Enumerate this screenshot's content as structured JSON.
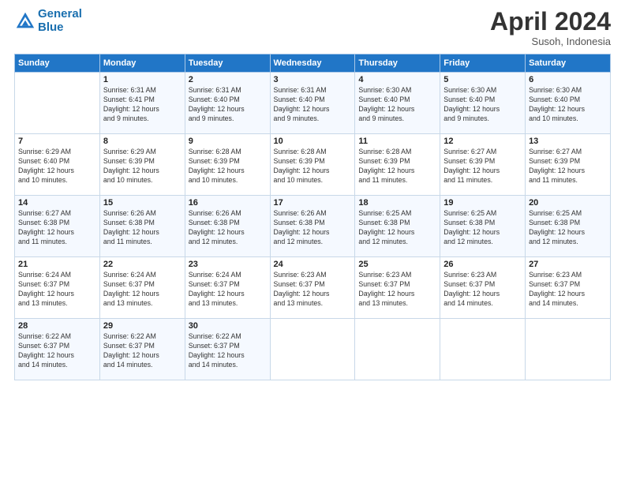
{
  "header": {
    "logo_line1": "General",
    "logo_line2": "Blue",
    "month": "April 2024",
    "location": "Susoh, Indonesia"
  },
  "days_of_week": [
    "Sunday",
    "Monday",
    "Tuesday",
    "Wednesday",
    "Thursday",
    "Friday",
    "Saturday"
  ],
  "weeks": [
    [
      {
        "day": "",
        "info": ""
      },
      {
        "day": "1",
        "info": "Sunrise: 6:31 AM\nSunset: 6:41 PM\nDaylight: 12 hours\nand 9 minutes."
      },
      {
        "day": "2",
        "info": "Sunrise: 6:31 AM\nSunset: 6:40 PM\nDaylight: 12 hours\nand 9 minutes."
      },
      {
        "day": "3",
        "info": "Sunrise: 6:31 AM\nSunset: 6:40 PM\nDaylight: 12 hours\nand 9 minutes."
      },
      {
        "day": "4",
        "info": "Sunrise: 6:30 AM\nSunset: 6:40 PM\nDaylight: 12 hours\nand 9 minutes."
      },
      {
        "day": "5",
        "info": "Sunrise: 6:30 AM\nSunset: 6:40 PM\nDaylight: 12 hours\nand 9 minutes."
      },
      {
        "day": "6",
        "info": "Sunrise: 6:30 AM\nSunset: 6:40 PM\nDaylight: 12 hours\nand 10 minutes."
      }
    ],
    [
      {
        "day": "7",
        "info": "Sunrise: 6:29 AM\nSunset: 6:40 PM\nDaylight: 12 hours\nand 10 minutes."
      },
      {
        "day": "8",
        "info": "Sunrise: 6:29 AM\nSunset: 6:39 PM\nDaylight: 12 hours\nand 10 minutes."
      },
      {
        "day": "9",
        "info": "Sunrise: 6:28 AM\nSunset: 6:39 PM\nDaylight: 12 hours\nand 10 minutes."
      },
      {
        "day": "10",
        "info": "Sunrise: 6:28 AM\nSunset: 6:39 PM\nDaylight: 12 hours\nand 10 minutes."
      },
      {
        "day": "11",
        "info": "Sunrise: 6:28 AM\nSunset: 6:39 PM\nDaylight: 12 hours\nand 11 minutes."
      },
      {
        "day": "12",
        "info": "Sunrise: 6:27 AM\nSunset: 6:39 PM\nDaylight: 12 hours\nand 11 minutes."
      },
      {
        "day": "13",
        "info": "Sunrise: 6:27 AM\nSunset: 6:39 PM\nDaylight: 12 hours\nand 11 minutes."
      }
    ],
    [
      {
        "day": "14",
        "info": "Sunrise: 6:27 AM\nSunset: 6:38 PM\nDaylight: 12 hours\nand 11 minutes."
      },
      {
        "day": "15",
        "info": "Sunrise: 6:26 AM\nSunset: 6:38 PM\nDaylight: 12 hours\nand 11 minutes."
      },
      {
        "day": "16",
        "info": "Sunrise: 6:26 AM\nSunset: 6:38 PM\nDaylight: 12 hours\nand 12 minutes."
      },
      {
        "day": "17",
        "info": "Sunrise: 6:26 AM\nSunset: 6:38 PM\nDaylight: 12 hours\nand 12 minutes."
      },
      {
        "day": "18",
        "info": "Sunrise: 6:25 AM\nSunset: 6:38 PM\nDaylight: 12 hours\nand 12 minutes."
      },
      {
        "day": "19",
        "info": "Sunrise: 6:25 AM\nSunset: 6:38 PM\nDaylight: 12 hours\nand 12 minutes."
      },
      {
        "day": "20",
        "info": "Sunrise: 6:25 AM\nSunset: 6:38 PM\nDaylight: 12 hours\nand 12 minutes."
      }
    ],
    [
      {
        "day": "21",
        "info": "Sunrise: 6:24 AM\nSunset: 6:37 PM\nDaylight: 12 hours\nand 13 minutes."
      },
      {
        "day": "22",
        "info": "Sunrise: 6:24 AM\nSunset: 6:37 PM\nDaylight: 12 hours\nand 13 minutes."
      },
      {
        "day": "23",
        "info": "Sunrise: 6:24 AM\nSunset: 6:37 PM\nDaylight: 12 hours\nand 13 minutes."
      },
      {
        "day": "24",
        "info": "Sunrise: 6:23 AM\nSunset: 6:37 PM\nDaylight: 12 hours\nand 13 minutes."
      },
      {
        "day": "25",
        "info": "Sunrise: 6:23 AM\nSunset: 6:37 PM\nDaylight: 12 hours\nand 13 minutes."
      },
      {
        "day": "26",
        "info": "Sunrise: 6:23 AM\nSunset: 6:37 PM\nDaylight: 12 hours\nand 14 minutes."
      },
      {
        "day": "27",
        "info": "Sunrise: 6:23 AM\nSunset: 6:37 PM\nDaylight: 12 hours\nand 14 minutes."
      }
    ],
    [
      {
        "day": "28",
        "info": "Sunrise: 6:22 AM\nSunset: 6:37 PM\nDaylight: 12 hours\nand 14 minutes."
      },
      {
        "day": "29",
        "info": "Sunrise: 6:22 AM\nSunset: 6:37 PM\nDaylight: 12 hours\nand 14 minutes."
      },
      {
        "day": "30",
        "info": "Sunrise: 6:22 AM\nSunset: 6:37 PM\nDaylight: 12 hours\nand 14 minutes."
      },
      {
        "day": "",
        "info": ""
      },
      {
        "day": "",
        "info": ""
      },
      {
        "day": "",
        "info": ""
      },
      {
        "day": "",
        "info": ""
      }
    ]
  ]
}
